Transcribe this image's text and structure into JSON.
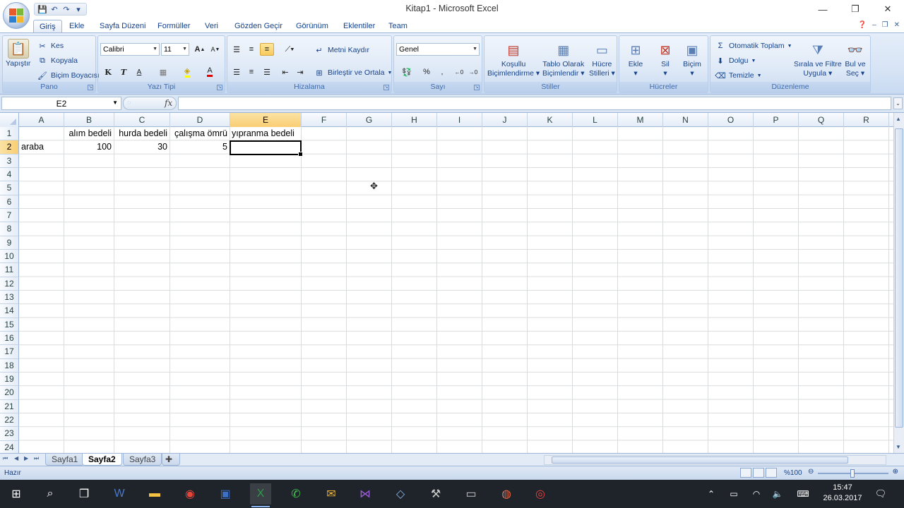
{
  "window": {
    "title": "Kitap1 - Microsoft Excel",
    "controls": {
      "minimize": "—",
      "restore": "❐",
      "close": "✕"
    }
  },
  "qat": {
    "save_icon": "💾",
    "undo_icon": "↶",
    "redo_icon": "↷",
    "customize_icon": "▾"
  },
  "tabs": [
    {
      "label": "Giriş",
      "active": true
    },
    {
      "label": "Ekle"
    },
    {
      "label": "Sayfa Düzeni"
    },
    {
      "label": "Formüller"
    },
    {
      "label": "Veri"
    },
    {
      "label": "Gözden Geçir"
    },
    {
      "label": "Görünüm"
    },
    {
      "label": "Eklentiler"
    },
    {
      "label": "Team"
    }
  ],
  "ribbon": {
    "clipboard": {
      "label": "Pano",
      "paste": "Yapıştır",
      "cut": "Kes",
      "copy": "Kopyala",
      "format_painter": "Biçim Boyacısı"
    },
    "font": {
      "label": "Yazı Tipi",
      "name": "Calibri",
      "size": "11",
      "bold": "K",
      "italic": "T",
      "underline": "A",
      "grow": "A",
      "shrink": "A"
    },
    "alignment": {
      "label": "Hizalama",
      "wrap_text": "Metni Kaydır",
      "merge_center": "Birleştir ve Ortala"
    },
    "number": {
      "label": "Sayı",
      "format": "Genel",
      "percent": "%",
      "comma": "‚"
    },
    "styles": {
      "label": "Stiller",
      "conditional_1": "Koşullu",
      "conditional_2": "Biçimlendirme",
      "table_1": "Tablo Olarak",
      "table_2": "Biçimlendir",
      "cell_1": "Hücre",
      "cell_2": "Stilleri"
    },
    "cells": {
      "label": "Hücreler",
      "insert": "Ekle",
      "delete": "Sil",
      "format": "Biçim"
    },
    "editing": {
      "label": "Düzenleme",
      "autosum": "Otomatik Toplam",
      "fill": "Dolgu",
      "clear": "Temizle",
      "sort_1": "Sırala ve Filtre",
      "sort_2": "Uygula",
      "find_1": "Bul ve",
      "find_2": "Seç"
    }
  },
  "formula_bar": {
    "name_box": "E2",
    "fx": "fx",
    "content": ""
  },
  "columns": [
    "A",
    "B",
    "C",
    "D",
    "E",
    "F",
    "G",
    "H",
    "I",
    "J",
    "K",
    "L",
    "M",
    "N",
    "O",
    "P",
    "Q",
    "R"
  ],
  "rows": [
    "1",
    "2",
    "3",
    "4",
    "5",
    "6",
    "7",
    "8",
    "9",
    "10",
    "11",
    "12",
    "13",
    "14",
    "15",
    "16",
    "17",
    "18",
    "19",
    "20",
    "21",
    "22",
    "23",
    "24"
  ],
  "cells": {
    "B1": "alım bedeli",
    "C1": "hurda bedeli",
    "D1": "çalışma ömrü",
    "E1": "yıpranma bedeli",
    "A2": "araba",
    "B2": "100",
    "C2": "30",
    "D2": "5"
  },
  "active_cell": "E2",
  "sheets": [
    {
      "label": "Sayfa1"
    },
    {
      "label": "Sayfa2",
      "active": true
    },
    {
      "label": "Sayfa3"
    }
  ],
  "status": {
    "text": "Hazır",
    "zoom": "%100"
  },
  "taskbar": {
    "time": "15:47",
    "date": "26.03.2017"
  }
}
